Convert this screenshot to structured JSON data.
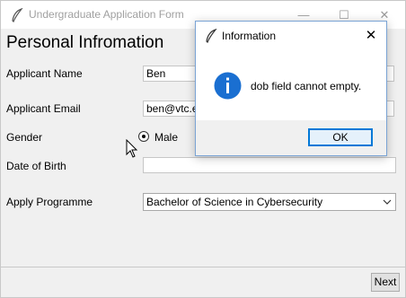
{
  "window": {
    "title": "Undergraduate Application Form",
    "minimize_glyph": "—",
    "maximize_glyph": "☐",
    "close_glyph": "✕"
  },
  "form": {
    "heading": "Personal Infromation",
    "name_label": "Applicant Name",
    "name_value": "Ben",
    "email_label": "Applicant Email",
    "email_value": "ben@vtc.e",
    "gender_label": "Gender",
    "gender_option": "Male",
    "dob_label": "Date of Birth",
    "dob_value": "",
    "programme_label": "Apply Programme",
    "programme_value": "Bachelor of Science in Cybersecurity",
    "next_button": "Next"
  },
  "dialog": {
    "title": "Information",
    "close_glyph": "✕",
    "message": "dob field cannot empty.",
    "ok_button": "OK",
    "icon": "info-icon"
  },
  "colors": {
    "info_blue": "#1a6fd1",
    "focus_border": "#0078d7"
  }
}
